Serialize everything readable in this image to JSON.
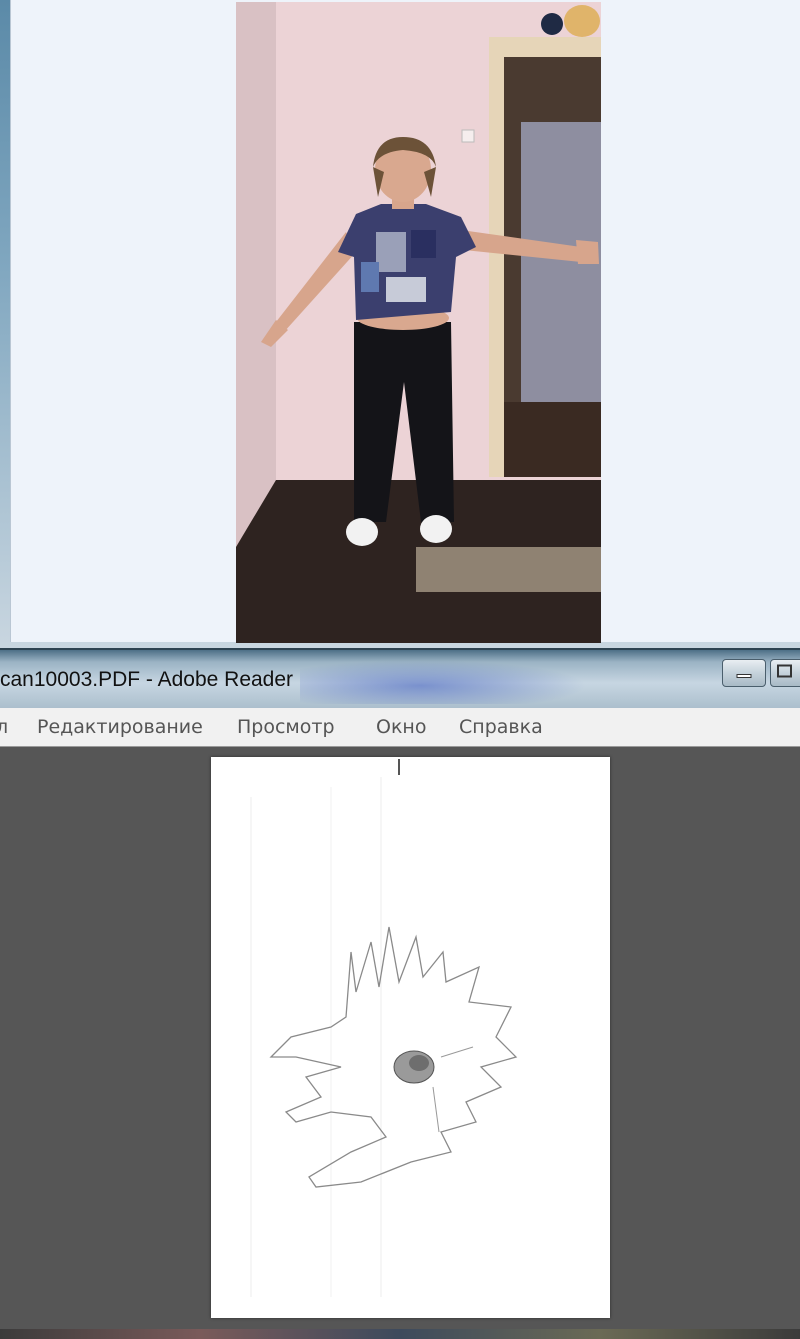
{
  "reader": {
    "title": "can10003.PDF - Adobe Reader",
    "menu": [
      {
        "label": "л"
      },
      {
        "label": "Редактирование"
      },
      {
        "label": "Просмотр"
      },
      {
        "label": "Окно"
      },
      {
        "label": "Справка"
      }
    ],
    "window_buttons": [
      "minimize-icon",
      "maximize-icon"
    ]
  },
  "colors": {
    "viewer_background": "#eef3fa",
    "reader_background": "#565656",
    "menubar_background": "#f1f1f1"
  }
}
